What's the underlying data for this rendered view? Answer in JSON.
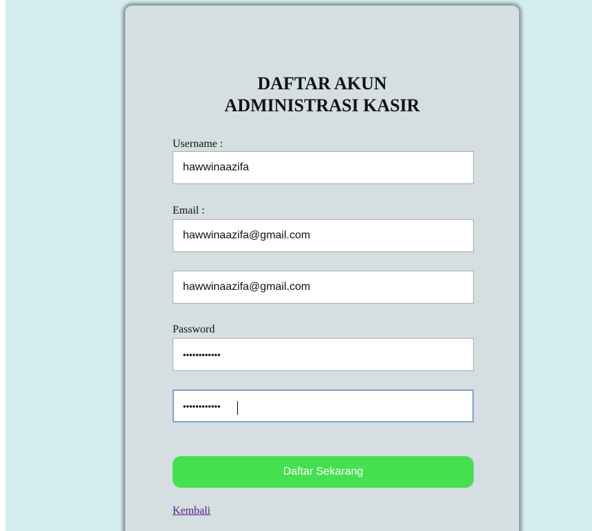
{
  "form": {
    "title_line1": "DAFTAR AKUN",
    "title_line2": "ADMINISTRASI KASIR",
    "username_label": "Username :",
    "username_value": "hawwinaazifa",
    "email_label": "Email :",
    "email_value": "hawwinaazifa@gmail.com",
    "email_confirm_value": "hawwinaazifa@gmail.com",
    "password_label": "Password",
    "password_value": "••••••••••••",
    "password_confirm_value": "••••••••••••",
    "submit_label": "Daftar Sekarang",
    "back_link_label": "Kembali"
  },
  "colors": {
    "page_background": "#d5edf0",
    "card_background": "#d5dee0",
    "submit_button": "#45e04f",
    "link": "#551a8b",
    "focus_border": "#7da1d6"
  }
}
